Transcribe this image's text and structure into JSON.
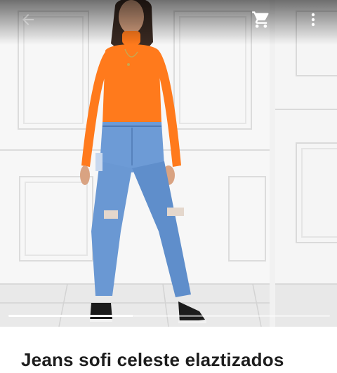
{
  "appbar": {
    "back_icon": "arrow-left-icon",
    "cart_icon": "shopping-cart-icon",
    "more_icon": "more-vert-icon"
  },
  "gallery": {
    "image_count": 2,
    "current_index": 1,
    "indicator_color": "#ffffff"
  },
  "product": {
    "title": "Jeans sofi celeste elaztizados"
  },
  "colors": {
    "top": "#ff7a1c",
    "jeans": "#6d9bd6",
    "title_text": "#1d1d1d"
  }
}
